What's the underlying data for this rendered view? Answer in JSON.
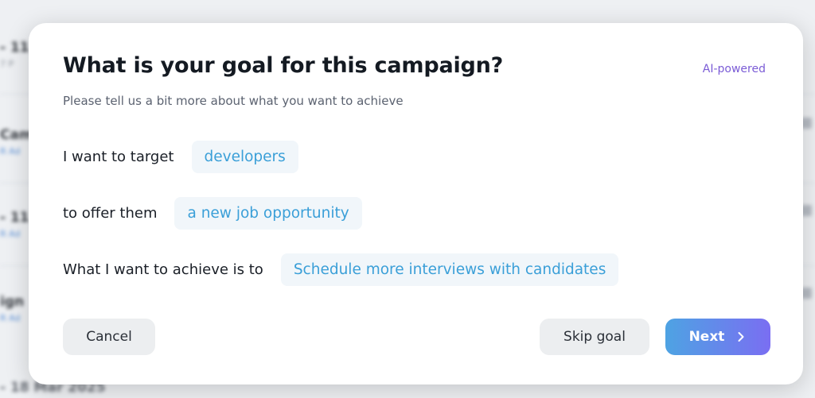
{
  "background": {
    "items": [
      {
        "title": "- 11",
        "sub": "7 P"
      },
      {
        "title": "Cam",
        "sub": "R Ad"
      },
      {
        "title": "- 11",
        "sub": "R Ad"
      },
      {
        "title": "ign",
        "sub": "R Ad"
      },
      {
        "title": "- 18 Mar 2025",
        "sub": ""
      }
    ]
  },
  "modal": {
    "title": "What is your goal for this campaign?",
    "ai_badge": "AI-powered",
    "subtitle": "Please tell us a bit more about what you want to achieve",
    "rows": [
      {
        "label": "I want to target",
        "value": "developers"
      },
      {
        "label": "to offer them",
        "value": "a new job opportunity"
      },
      {
        "label": "What I want to achieve is to",
        "value": "Schedule more interviews with candidates"
      }
    ],
    "buttons": {
      "cancel": "Cancel",
      "skip": "Skip goal",
      "next": "Next"
    }
  },
  "colors": {
    "accent": "#3a9fd8",
    "badge": "#7b5cd6",
    "next_gradient_start": "#4ea3e3",
    "next_gradient_end": "#7a6ef2"
  }
}
